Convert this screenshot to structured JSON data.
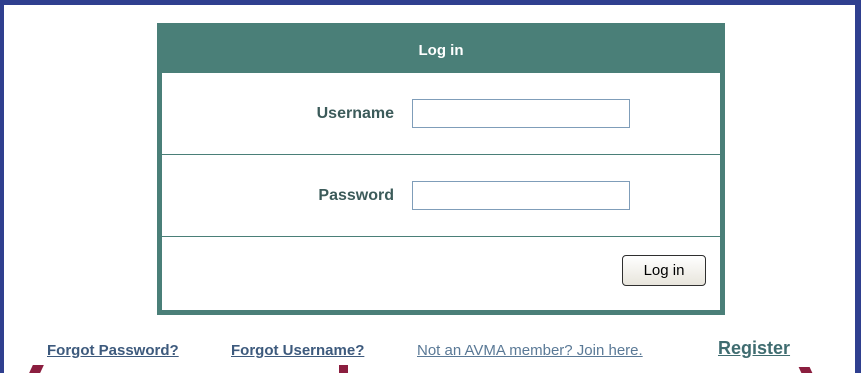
{
  "login": {
    "title": "Log in",
    "username_label": "Username",
    "username_value": "",
    "password_label": "Password",
    "password_value": "",
    "submit_label": "Log in"
  },
  "links": {
    "forgot_password": "Forgot Password?",
    "forgot_username": "Forgot Username?",
    "join": "Not an AVMA member? Join here.",
    "register": "Register"
  },
  "colors": {
    "frame_border": "#2f3f8f",
    "box_accent": "#4a7f78",
    "label_text": "#3c5b5a",
    "link_text": "#3d5a7d",
    "annotation_arrow": "#8b1e3f"
  }
}
